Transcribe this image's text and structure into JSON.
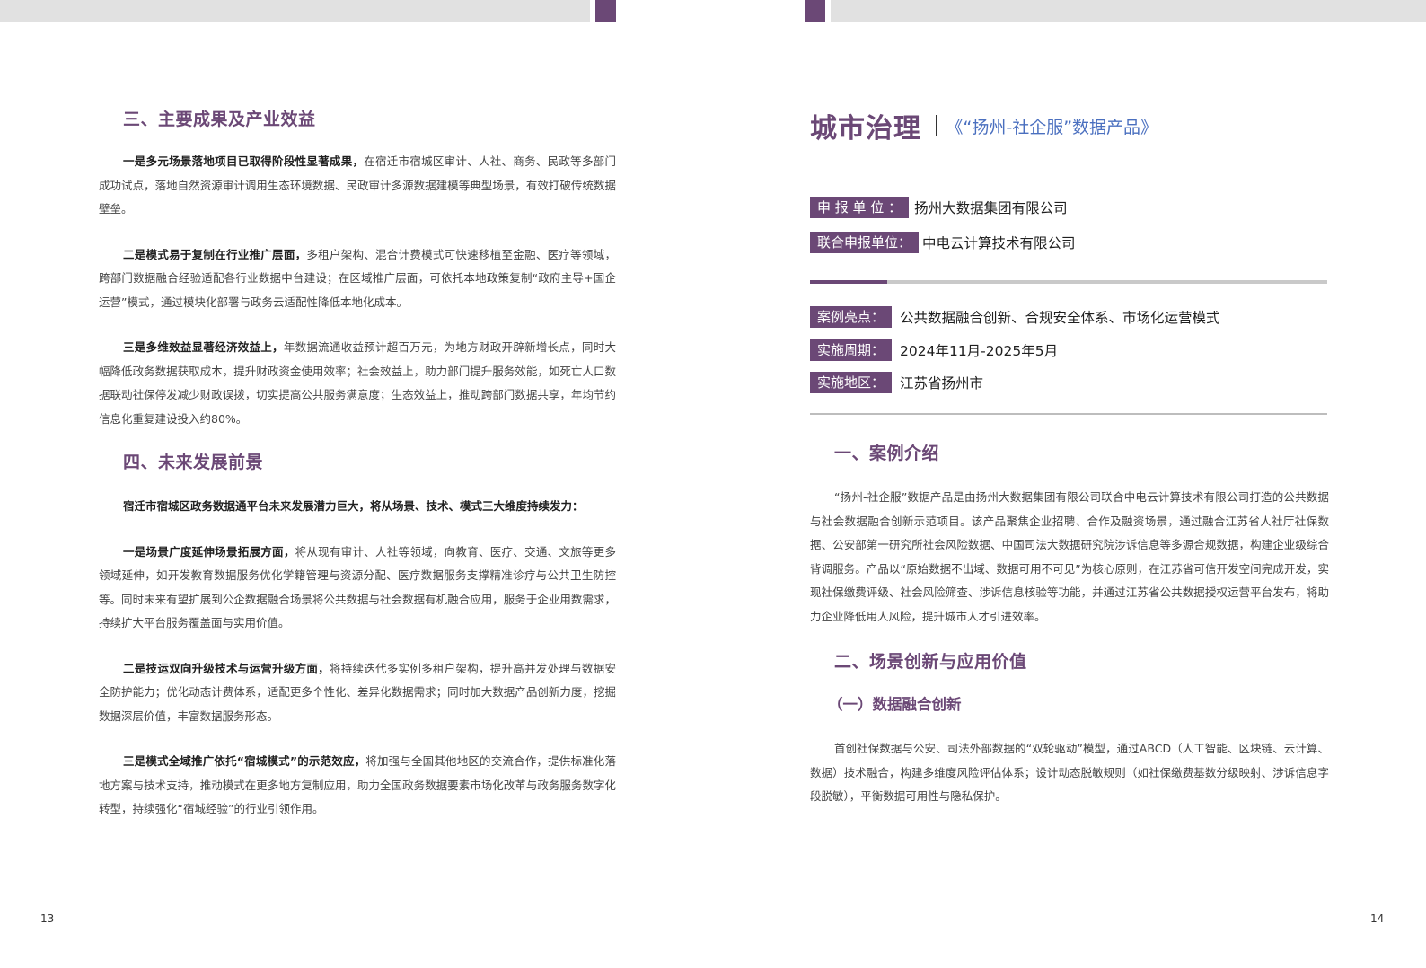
{
  "left_page": {
    "section3_title": "三、主要成果及产业效益",
    "p1_bold": "一是多元场景落地项目已取得阶段性显著成果，",
    "p1_text": "在宿迁市宿城区审计、人社、商务、民政等多部门成功试点，落地自然资源审计调用生态环境数据、民政审计多源数据建模等典型场景，有效打破传统数据壁垒。",
    "p2_bold": "二是模式易于复制在行业推广层面，",
    "p2_text": "多租户架构、混合计费模式可快速移植至金融、医疗等领域，跨部门数据融合经验适配各行业数据中台建设；在区域推广层面，可依托本地政策复制“政府主导+国企运营”模式，通过模块化部署与政务云适配性降低本地化成本。",
    "p3_bold": "三是多维效益显著经济效益上，",
    "p3_text": "年数据流通收益预计超百万元，为地方财政开辟新增长点，同时大幅降低政务数据获取成本，提升财政资金使用效率；社会效益上，助力部门提升服务效能，如死亡人口数据联动社保停发减少财政误拨，切实提高公共服务满意度；生态效益上，推动跨部门数据共享，年均节约信息化重复建设投入约80%。",
    "section4_title": "四、未来发展前景",
    "intro_bold": "宿迁市宿城区政务数据通平台未来发展潜力巨大，将从场景、技术、模式三大维度持续发力：",
    "p4_bold": "一是场景广度延伸场景拓展方面，",
    "p4_text": "将从现有审计、人社等领域，向教育、医疗、交通、文旅等更多领域延伸，如开发教育数据服务优化学籍管理与资源分配、医疗数据服务支撑精准诊疗与公共卫生防控等。同时未来有望扩展到公企数据融合场景将公共数据与社会数据有机融合应用，服务于企业用数需求，持续扩大平台服务覆盖面与实用价值。",
    "p5_bold": "二是技运双向升级技术与运营升级方面，",
    "p5_text": "将持续迭代多实例多租户架构，提升高并发处理与数据安全防护能力；优化动态计费体系，适配更多个性化、差异化数据需求；同时加大数据产品创新力度，挖掘数据深层价值，丰富数据服务形态。",
    "p6_bold": "三是模式全域推广依托“宿城模式”的示范效应，",
    "p6_text": "将加强与全国其他地区的交流合作，提供标准化落地方案与技术支持，推动模式在更多地方复制应用，助力全国政务数据要素市场化改革与政务服务数字化转型，持续强化“宿城经验”的行业引领作用。",
    "page_number": "13"
  },
  "right_page": {
    "category": "城市治理",
    "product_title": "《“扬州-社企服”数据产品》",
    "applicant_label": "申 报 单 位 ：",
    "applicant_value": "扬州大数据集团有限公司",
    "co_applicant_label": "联合申报单位：",
    "co_applicant_value": "中电云计算技术有限公司",
    "highlight_label": "案例亮点：",
    "highlight_value": "公共数据融合创新、合规安全体系、市场化运营模式",
    "period_label": "实施周期：",
    "period_value": "2024年11月-2025年5月",
    "region_label": "实施地区：",
    "region_value": "江苏省扬州市",
    "section1_title": "一、案例介绍",
    "section1_text": "“扬州-社企服”数据产品是由扬州大数据集团有限公司联合中电云计算技术有限公司打造的公共数据与社会数据融合创新示范项目。该产品聚焦企业招聘、合作及融资场景，通过融合江苏省人社厅社保数据、公安部第一研究所社会风险数据、中国司法大数据研究院涉诉信息等多源合规数据，构建企业级综合背调服务。产品以“原始数据不出域、数据可用不可见”为核心原则，在江苏省可信开发空间完成开发，实现社保缴费评级、社会风险筛查、涉诉信息核验等功能，并通过江苏省公共数据授权运营平台发布，将助力企业降低用人风险，提升城市人才引进效率。",
    "section2_title": "二、场景创新与应用价值",
    "subsection1_title": "（一）数据融合创新",
    "subsection1_text": "首创社保数据与公安、司法外部数据的“双轮驱动”模型，通过ABCD（人工智能、区块链、云计算、数据）技术融合，构建多维度风险评估体系；设计动态脱敏规则（如社保缴费基数分级映射、涉诉信息字段脱敏），平衡数据可用性与隐私保护。",
    "page_number": "14"
  },
  "colors": {
    "accent_purple": "#6b4876",
    "title_blue": "#4a6fbf",
    "header_gray": "#e1e1e1"
  }
}
